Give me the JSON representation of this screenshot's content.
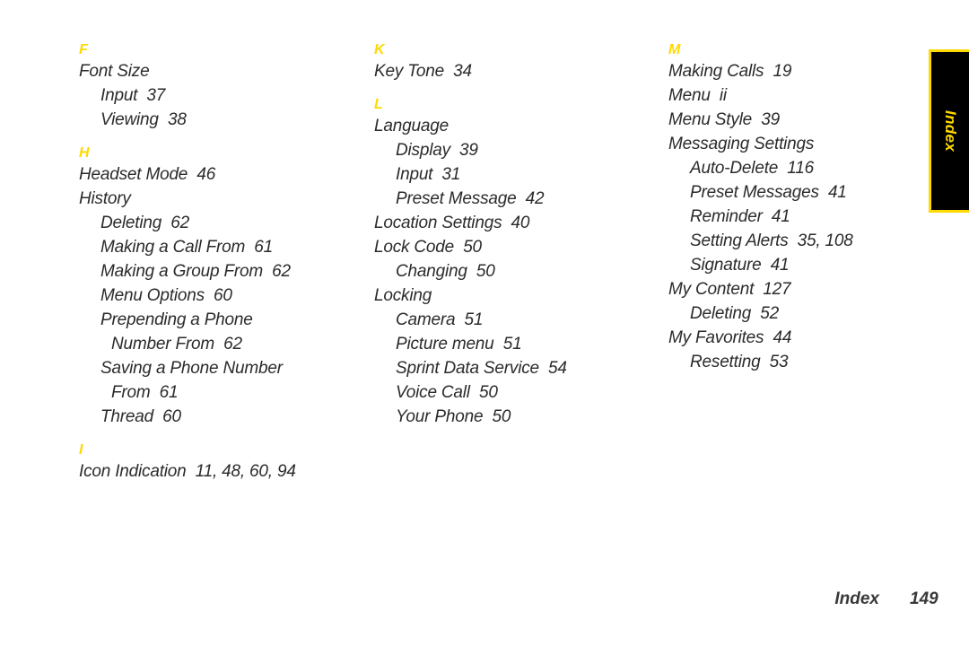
{
  "page": {
    "background_color": "#ffffff",
    "text_color": "#2c2a2b",
    "accent_color": "#ffd900"
  },
  "side_tab": {
    "label": "Index",
    "background_color": "#000000",
    "border_color": "#ffd900",
    "text_color": "#ffd900"
  },
  "footer": {
    "label": "Index",
    "page_number": "149"
  },
  "columns": [
    {
      "id": "column-1",
      "groups": [
        {
          "letter": "F",
          "entries": [
            {
              "text": "Font Size",
              "level": 0
            },
            {
              "text": "Input  37",
              "level": 1
            },
            {
              "text": "Viewing  38",
              "level": 1
            }
          ]
        },
        {
          "letter": "H",
          "entries": [
            {
              "text": "Headset Mode  46",
              "level": 0
            },
            {
              "text": "History",
              "level": 0
            },
            {
              "text": "Deleting  62",
              "level": 1
            },
            {
              "text": "Making a Call From  61",
              "level": 1
            },
            {
              "text": "Making a Group From  62",
              "level": 1
            },
            {
              "text": "Menu Options  60",
              "level": 1
            },
            {
              "text": "Prepending a Phone",
              "level": 1
            },
            {
              "text": "Number From  62",
              "level": 2
            },
            {
              "text": "Saving a Phone Number",
              "level": 1
            },
            {
              "text": "From  61",
              "level": 2
            },
            {
              "text": "Thread  60",
              "level": 1
            }
          ]
        },
        {
          "letter": "I",
          "entries": [
            {
              "text": "Icon Indication  11, 48, 60, 94",
              "level": 0
            }
          ]
        }
      ]
    },
    {
      "id": "column-2",
      "groups": [
        {
          "letter": "K",
          "entries": [
            {
              "text": "Key Tone  34",
              "level": 0
            }
          ]
        },
        {
          "letter": "L",
          "entries": [
            {
              "text": "Language",
              "level": 0
            },
            {
              "text": "Display  39",
              "level": 1
            },
            {
              "text": "Input  31",
              "level": 1
            },
            {
              "text": "Preset Message  42",
              "level": 1
            },
            {
              "text": "Location Settings  40",
              "level": 0
            },
            {
              "text": "Lock Code  50",
              "level": 0
            },
            {
              "text": "Changing  50",
              "level": 1
            },
            {
              "text": "Locking",
              "level": 0
            },
            {
              "text": "Camera  51",
              "level": 1
            },
            {
              "text": "Picture menu  51",
              "level": 1
            },
            {
              "text": "Sprint Data Service  54",
              "level": 1
            },
            {
              "text": "Voice Call  50",
              "level": 1
            },
            {
              "text": "Your Phone  50",
              "level": 1
            }
          ]
        }
      ]
    },
    {
      "id": "column-3",
      "groups": [
        {
          "letter": "M",
          "entries": [
            {
              "text": "Making Calls  19",
              "level": 0
            },
            {
              "text": "Menu  ii",
              "level": 0
            },
            {
              "text": "Menu Style  39",
              "level": 0
            },
            {
              "text": "Messaging Settings",
              "level": 0
            },
            {
              "text": "Auto-Delete  116",
              "level": 1
            },
            {
              "text": "Preset Messages  41",
              "level": 1
            },
            {
              "text": "Reminder  41",
              "level": 1
            },
            {
              "text": "Setting Alerts  35, 108",
              "level": 1
            },
            {
              "text": "Signature  41",
              "level": 1
            },
            {
              "text": "My Content  127",
              "level": 0
            },
            {
              "text": "Deleting  52",
              "level": 1
            },
            {
              "text": "My Favorites  44",
              "level": 0
            },
            {
              "text": "Resetting  53",
              "level": 1
            }
          ]
        }
      ]
    }
  ]
}
